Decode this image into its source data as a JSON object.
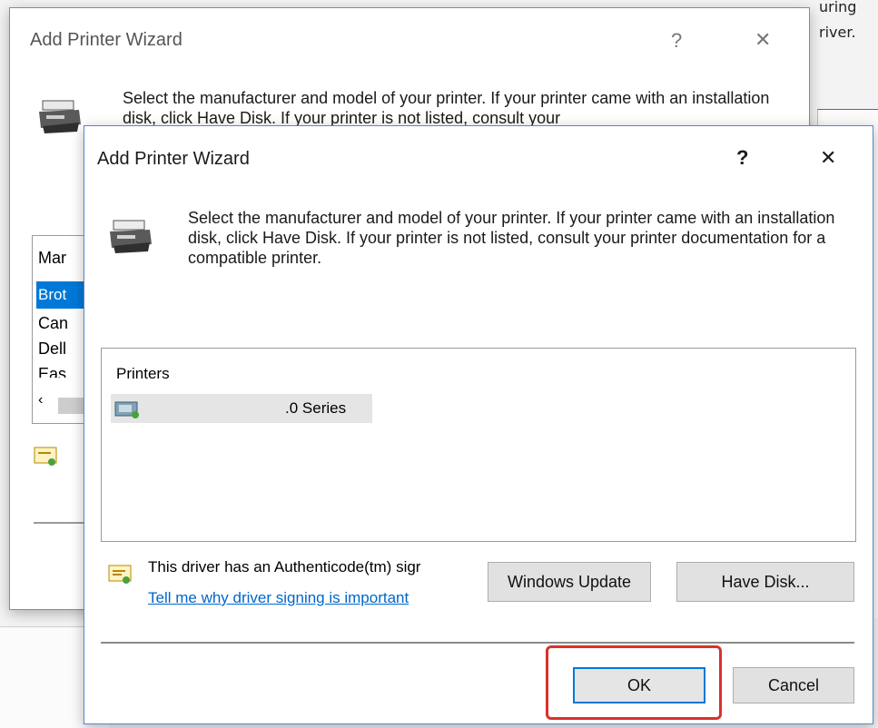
{
  "background": {
    "right_text_line1": "uring",
    "right_text_line2": "river."
  },
  "back_window": {
    "title": "Add Printer Wizard",
    "help_glyph": "?",
    "close_glyph": "✕",
    "description": "Select the manufacturer and model of your printer. If your printer came with an installation disk, click Have Disk. If your printer is not listed, consult your",
    "list_partial": [
      "Mar",
      "Brot",
      "Can",
      "Dell",
      "Eas"
    ]
  },
  "dialog": {
    "title": "Add Printer Wizard",
    "help_glyph": "?",
    "close_glyph": "✕",
    "description": "Select the manufacturer and model of your printer. If your printer came with an installation disk, click Have Disk. If your printer is not listed, consult your printer documentation for a compatible printer.",
    "list_header": "Printers",
    "printers": [
      ".0 Series"
    ],
    "signature_text": "This driver has an Authenticode(tm) sigr",
    "signing_link": "Tell me why driver signing is important",
    "windows_update_label": "Windows Update",
    "have_disk_label": "Have Disk...",
    "ok_label": "OK",
    "cancel_label": "Cancel"
  },
  "colors": {
    "highlight": "#d9312b",
    "selection": "#0078d7",
    "link": "#0066cc",
    "dialog_border": "#5a86c7"
  }
}
